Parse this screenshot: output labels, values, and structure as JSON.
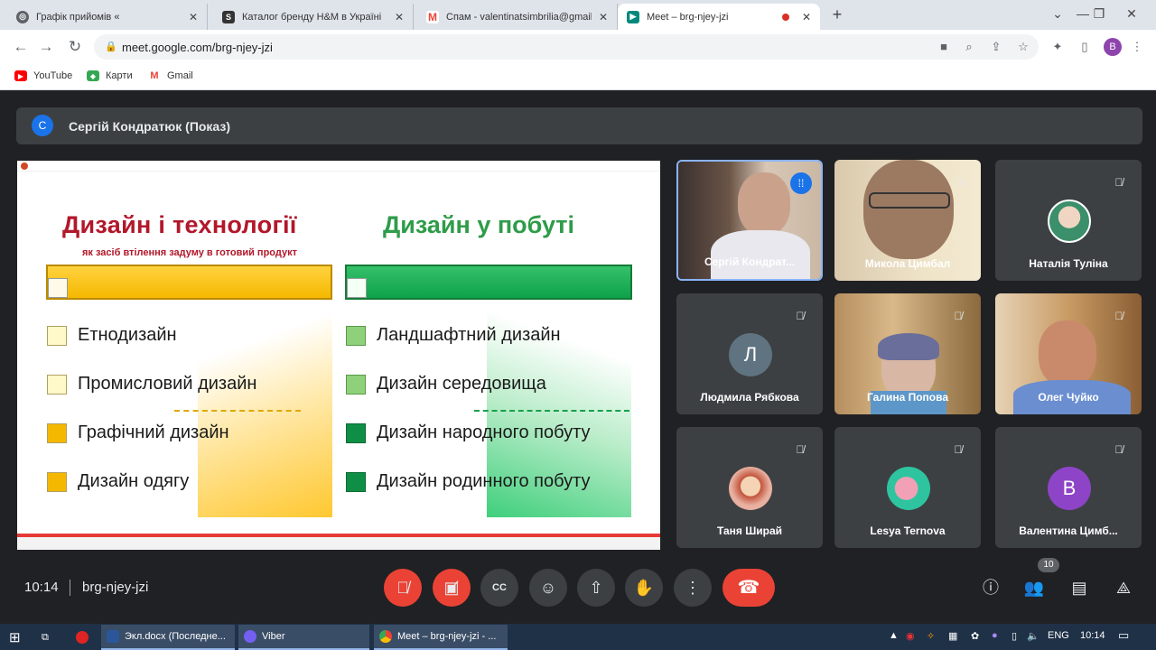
{
  "browser": {
    "tabs": [
      {
        "title": "Графік прийомів «",
        "icon": "google-sheets-icon",
        "color": "#5f6368"
      },
      {
        "title": "Каталог бренду H&M в Україні",
        "icon": "shop-s-icon",
        "color": "#333333"
      },
      {
        "title": "Спам - valentinatsimbrilia@gmail",
        "icon": "gmail-icon",
        "color": "#ea4335"
      },
      {
        "title": "Meet – brg-njey-jzi",
        "icon": "meet-icon",
        "color": "#00897b"
      }
    ],
    "url": "meet.google.com/brg-njey-jzi",
    "profile_initial": "B",
    "bookmarks": [
      {
        "label": "YouTube",
        "icon": "youtube-icon"
      },
      {
        "label": "Карти",
        "icon": "maps-icon"
      },
      {
        "label": "Gmail",
        "icon": "gmail-icon"
      }
    ]
  },
  "meet": {
    "presenter": {
      "initial": "С",
      "text": "Сергій Кондратюк (Показ)"
    },
    "slide": {
      "title_left": "Дизайн і технології",
      "subtitle_left": "як засіб втілення задуму в готовий продукт",
      "title_right": "Дизайн у побуті",
      "left_items": [
        "Етнодизайн",
        "Промисловий дизайн",
        "Графічний дизайн",
        "Дизайн одягу"
      ],
      "right_items": [
        "Ландшафтний дизайн",
        "Дизайн середовища",
        "Дизайн народного побуту",
        "Дизайн родинного побуту"
      ],
      "accent_yellow": "#f5b800",
      "accent_green": "#12a34d"
    },
    "participants": [
      {
        "name": "Сергій Кондрат...",
        "type": "video",
        "speaking": true
      },
      {
        "name": "Микола Цимбал",
        "type": "video",
        "muted": true
      },
      {
        "name": "Наталія Туліна",
        "type": "avatar-photo",
        "muted": true
      },
      {
        "name": "Людмила Рябкова",
        "type": "initial",
        "initial": "Л",
        "color": "#5f7380",
        "muted": true
      },
      {
        "name": "Галина Попова",
        "type": "video",
        "muted": true
      },
      {
        "name": "Олег Чуйко",
        "type": "video",
        "muted": true
      },
      {
        "name": "Таня Ширай",
        "type": "avatar-photo",
        "muted": true
      },
      {
        "name": "Lesya Ternova",
        "type": "avatar-photo",
        "muted": true
      },
      {
        "name": "Валентина Цимб...",
        "type": "initial",
        "initial": "В",
        "color": "#8e44c6",
        "muted": true
      }
    ],
    "time": "10:14",
    "meeting_code": "brg-njey-jzi",
    "participant_count": "10"
  },
  "taskbar": {
    "apps": [
      {
        "label": "Экл.docx (Последне...",
        "icon": "word-icon"
      },
      {
        "label": "Viber",
        "icon": "viber-icon"
      },
      {
        "label": "Meet – brg-njey-jzi - ...",
        "icon": "chrome-icon"
      }
    ],
    "lang": "ENG",
    "clock": "10:14"
  }
}
